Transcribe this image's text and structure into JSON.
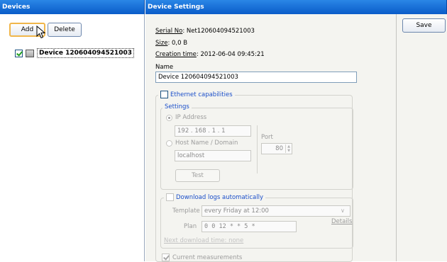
{
  "devices_pane": {
    "title": "Devices",
    "add_label": "Add",
    "delete_label": "Delete",
    "tree": [
      {
        "label": "Device 120604094521003",
        "checked": true
      }
    ]
  },
  "settings_pane": {
    "title": "Device Settings",
    "save_label": "Save",
    "serial_key": "Serial No",
    "serial_value": ": Net120604094521003",
    "size_key": "Size",
    "size_value": ": 0,0 B",
    "created_key": "Creation time",
    "created_value": ": 2012-06-04 09:45:21",
    "name_label": "Name",
    "name_value": "Device 120604094521003",
    "ethernet": {
      "label": "Ethernet capabilities",
      "checked": false,
      "settings_label": "Settings",
      "ip_label": "IP Address",
      "ip_value": "192 . 168 .  1  .  1",
      "host_label": "Host Name / Domain",
      "host_value": "localhost",
      "port_label": "Port",
      "port_value": "80",
      "test_label": "Test",
      "download": {
        "label": "Download logs automatically",
        "checked": false,
        "template_label": "Template",
        "template_value": "every Friday at 12:00",
        "plan_label": "Plan",
        "plan_value": "0  0  12  *  *  5  *",
        "details_label": "Details",
        "next_download": "Next download time: none"
      },
      "current_measurements_label": "Current measurements",
      "current_measurements_checked": true
    }
  },
  "colors": {
    "header_blue": "#0a5cc9",
    "legend_blue": "#1a4ec9",
    "add_focus": "#f0b64a"
  }
}
